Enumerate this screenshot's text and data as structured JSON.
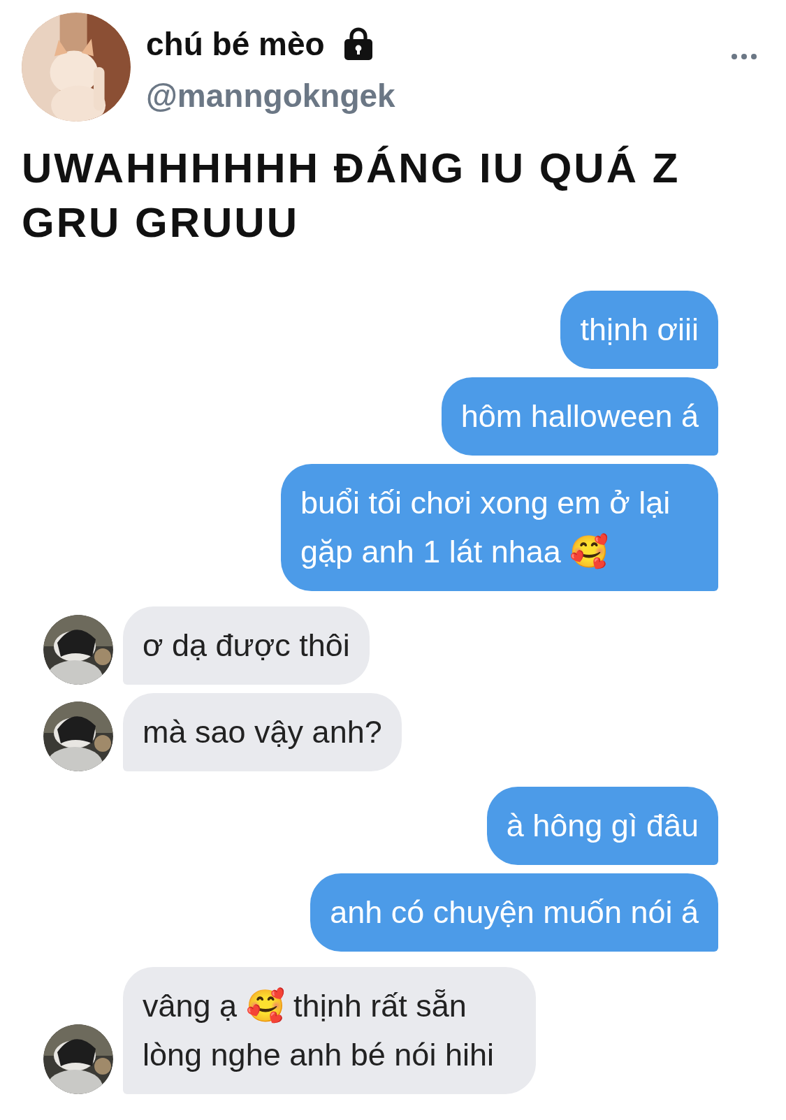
{
  "author": {
    "name": "chú bé mèo",
    "protected": true,
    "handle": "@manngokngek"
  },
  "tweet": {
    "text": "UWAHHHHHH ĐÁNG IU QUÁ Z GRU GRUUU"
  },
  "chat": [
    {
      "kind": "sent",
      "text": "thịnh ơiii"
    },
    {
      "kind": "sent",
      "text": "hôm halloween á"
    },
    {
      "kind": "sent",
      "text": "buổi tối chơi xong em ở lại gặp anh 1 lát nhaa 🥰"
    },
    {
      "kind": "received",
      "text": "ơ dạ được thôi"
    },
    {
      "kind": "received",
      "text": "mà sao vậy anh?"
    },
    {
      "kind": "sent",
      "text": "à hông gì đâu"
    },
    {
      "kind": "sent",
      "text": "anh có chuyện muốn nói á"
    },
    {
      "kind": "received",
      "text": "vâng ạ 🥰  thịnh rất sẵn lòng nghe anh bé nói hihi"
    }
  ]
}
